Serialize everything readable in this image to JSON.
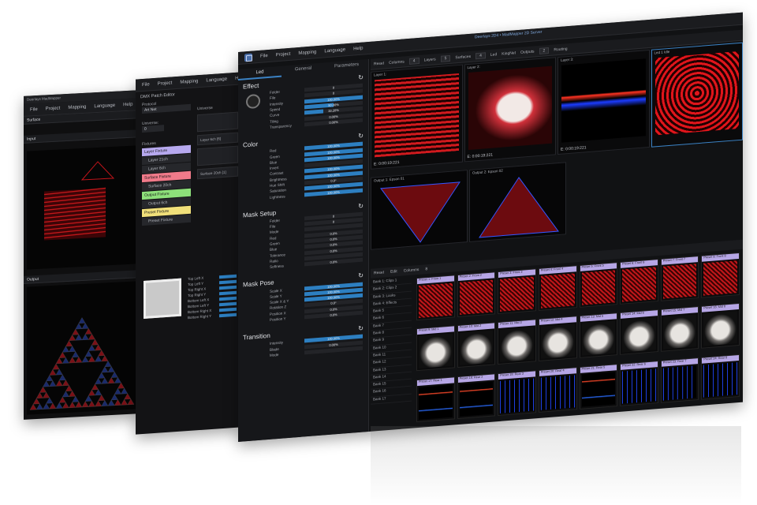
{
  "win1": {
    "title": "Deerlays MadMapper",
    "menu": [
      "File",
      "Project",
      "Mapping",
      "Language",
      "Help"
    ],
    "surface_label": "Surface",
    "input_section": "Input",
    "output_section": "Output"
  },
  "win2": {
    "menu": [
      "File",
      "Project",
      "Mapping",
      "Language",
      "Help"
    ],
    "title": "DMX Patch Editor",
    "protocol_label": "Protocol",
    "protocol_value": "Art Net",
    "universe_label": "Universe:",
    "universe_value": "0",
    "universe_header": "Universe",
    "fixtures_label": "Fixtures",
    "fixtures": [
      {
        "label": "Layer Fixture",
        "color": "#b7a9ef",
        "kind": "header"
      },
      {
        "label": "Layer 21ch",
        "kind": "sub"
      },
      {
        "label": "Layer 6ch",
        "kind": "sub"
      },
      {
        "label": "Surface Fixture",
        "color": "#f07a8a",
        "kind": "header"
      },
      {
        "label": "Surface 20ch",
        "kind": "sub"
      },
      {
        "label": "Output Fixture",
        "color": "#8de07a",
        "kind": "header"
      },
      {
        "label": "Output 6ch",
        "kind": "sub"
      },
      {
        "label": "Preset Fixture",
        "color": "#f1e07a",
        "kind": "header"
      },
      {
        "label": "Preset Fixture",
        "kind": "sub"
      }
    ],
    "cards": [
      "Layer 6ch [6]",
      "Surface 20ch [1]"
    ],
    "corner_labels": [
      "Top Left X",
      "Top Left Y",
      "Top Right X",
      "Top Right Y",
      "Bottom Left X",
      "Bottom Left Y",
      "Bottom Right X",
      "Bottom Right Y"
    ]
  },
  "win3": {
    "menu": [
      "File",
      "Project",
      "Mapping",
      "Language",
      "Help"
    ],
    "window_title": "Deerlays 2D4 • MadMapper 2D Server",
    "tabs": [
      "Led",
      "General",
      "Parameters"
    ],
    "groups": [
      {
        "title": "Effect",
        "rows": [
          {
            "label": "Folder",
            "value": "0",
            "fill": 0
          },
          {
            "label": "File",
            "value": "0",
            "fill": 0
          },
          {
            "label": "Intensity",
            "value": "100.00%",
            "fill": 1.0
          },
          {
            "label": "Speed",
            "value": "50.00%",
            "fill": 0.5
          },
          {
            "label": "Curve",
            "value": "33.20%",
            "fill": 0.33
          },
          {
            "label": "Tiling",
            "value": "0.00%",
            "fill": 0
          },
          {
            "label": "Transparency",
            "value": "0.00%",
            "fill": 0
          }
        ]
      },
      {
        "title": "Color",
        "rows": [
          {
            "label": "Red",
            "value": "100.00%",
            "fill": 1.0
          },
          {
            "label": "Green",
            "value": "100.00%",
            "fill": 1.0
          },
          {
            "label": "Blue",
            "value": "100.00%",
            "fill": 1.0
          },
          {
            "label": "Invert",
            "value": "",
            "fill": 0
          },
          {
            "label": "Contrast",
            "value": "100.00%",
            "fill": 1.0
          },
          {
            "label": "Brightness",
            "value": "100.00%",
            "fill": 1.0
          },
          {
            "label": "Hue Shift",
            "value": "0.0°",
            "fill": 0
          },
          {
            "label": "Saturation",
            "value": "100.00%",
            "fill": 1.0
          },
          {
            "label": "Lightness",
            "value": "100.00%",
            "fill": 1.0
          }
        ]
      },
      {
        "title": "Mask Setup",
        "rows": [
          {
            "label": "Folder",
            "value": "0",
            "fill": 0
          },
          {
            "label": "File",
            "value": "0",
            "fill": 0
          },
          {
            "label": "Mode",
            "value": "",
            "fill": 0
          },
          {
            "label": "Red",
            "value": "0.0%",
            "fill": 0
          },
          {
            "label": "Green",
            "value": "0.0%",
            "fill": 0
          },
          {
            "label": "Blue",
            "value": "0.0%",
            "fill": 0
          },
          {
            "label": "Tolerance",
            "value": "0.0%",
            "fill": 0
          },
          {
            "label": "Ratio",
            "value": "",
            "fill": 0
          },
          {
            "label": "Softness",
            "value": "0.0%",
            "fill": 0
          }
        ]
      },
      {
        "title": "Mask Pose",
        "rows": [
          {
            "label": "Scale X",
            "value": "100.00%",
            "fill": 1.0
          },
          {
            "label": "Scale Y",
            "value": "100.00%",
            "fill": 1.0
          },
          {
            "label": "Scale X & Y",
            "value": "100.00%",
            "fill": 1.0
          },
          {
            "label": "Rotation Z",
            "value": "0.0°",
            "fill": 0
          },
          {
            "label": "Position X",
            "value": "0.0%",
            "fill": 0
          },
          {
            "label": "Position Y",
            "value": "0.0%",
            "fill": 0
          }
        ]
      },
      {
        "title": "Transition",
        "rows": [
          {
            "label": "Intensity",
            "value": "100.00%",
            "fill": 1.0
          },
          {
            "label": "Blade",
            "value": "0.00%",
            "fill": 0
          },
          {
            "label": "Mode",
            "value": "",
            "fill": 0
          }
        ]
      }
    ],
    "toolbar": [
      "Reset",
      "Columns",
      "4",
      "Layers",
      "5",
      "Surfaces",
      "4",
      "Led",
      "KingNet",
      "Outputs",
      "2",
      "Routing"
    ],
    "layers": [
      {
        "title": "Layer 1:",
        "time": "E: 0:00:19:221"
      },
      {
        "title": "Layer 2:",
        "time": "E: 0:00:19:221"
      },
      {
        "title": "Layer 3:",
        "time": "E: 0:00:19:221"
      },
      {
        "title": "Led 1 Idle",
        "time": ""
      }
    ],
    "outputs": [
      "Output 1: Epson 01",
      "Output 2: Epson 02"
    ],
    "clips_bar": [
      "Reset",
      "Edit",
      "Columns",
      "8"
    ],
    "banks": [
      "Bank 1: Clips 1",
      "Bank 2: Clips 2",
      "Bank 3: Looks",
      "Bank 4: Effects",
      "Bank 5",
      "Bank 6",
      "Bank 7",
      "Bank 8",
      "Bank 9",
      "Bank 10",
      "Bank 11",
      "Bank 12",
      "Bank 13",
      "Bank 14",
      "Bank 15",
      "Bank 16",
      "Bank 17"
    ],
    "clips": [
      {
        "label": "Preset 1: Front 1",
        "art": "red"
      },
      {
        "label": "Preset 2: Front 2",
        "art": "red"
      },
      {
        "label": "Preset 3: Front 3",
        "art": "red"
      },
      {
        "label": "Preset 4: Front 4",
        "art": "red"
      },
      {
        "label": "Preset 5: Front 5",
        "art": "red"
      },
      {
        "label": "Preset 6: Front 6",
        "art": "red"
      },
      {
        "label": "Preset 7: Front 7",
        "art": "red"
      },
      {
        "label": "Preset 8: Front 8",
        "art": "red"
      },
      {
        "label": "Preset 9: Mid 1",
        "art": "white"
      },
      {
        "label": "Preset 10: Mid 2",
        "art": "white"
      },
      {
        "label": "Preset 11: Mid 3",
        "art": "white"
      },
      {
        "label": "Preset 12: Mid 4",
        "art": "white"
      },
      {
        "label": "Preset 13: Mid 5",
        "art": "white"
      },
      {
        "label": "Preset 14: Mid 6",
        "art": "white"
      },
      {
        "label": "Preset 15: Mid 7",
        "art": "white"
      },
      {
        "label": "Preset 16: Mid 8",
        "art": "white"
      },
      {
        "label": "Preset 17: Rear 1",
        "art": "neon"
      },
      {
        "label": "Preset 18: Rear 2",
        "art": "neon"
      },
      {
        "label": "Preset 19: Rear 3",
        "art": "blue"
      },
      {
        "label": "Preset 20: Rear 4",
        "art": "blue"
      },
      {
        "label": "Preset 21: Rear 5",
        "art": "neon"
      },
      {
        "label": "Preset 22: Rear 6",
        "art": "blue"
      },
      {
        "label": "Preset 23: Rear 7",
        "art": "blue"
      },
      {
        "label": "Preset 24: Rear 8",
        "art": "blue"
      }
    ]
  },
  "colors": {
    "accent": "#2d7fc1",
    "clip_label": "#b6a6e6"
  }
}
